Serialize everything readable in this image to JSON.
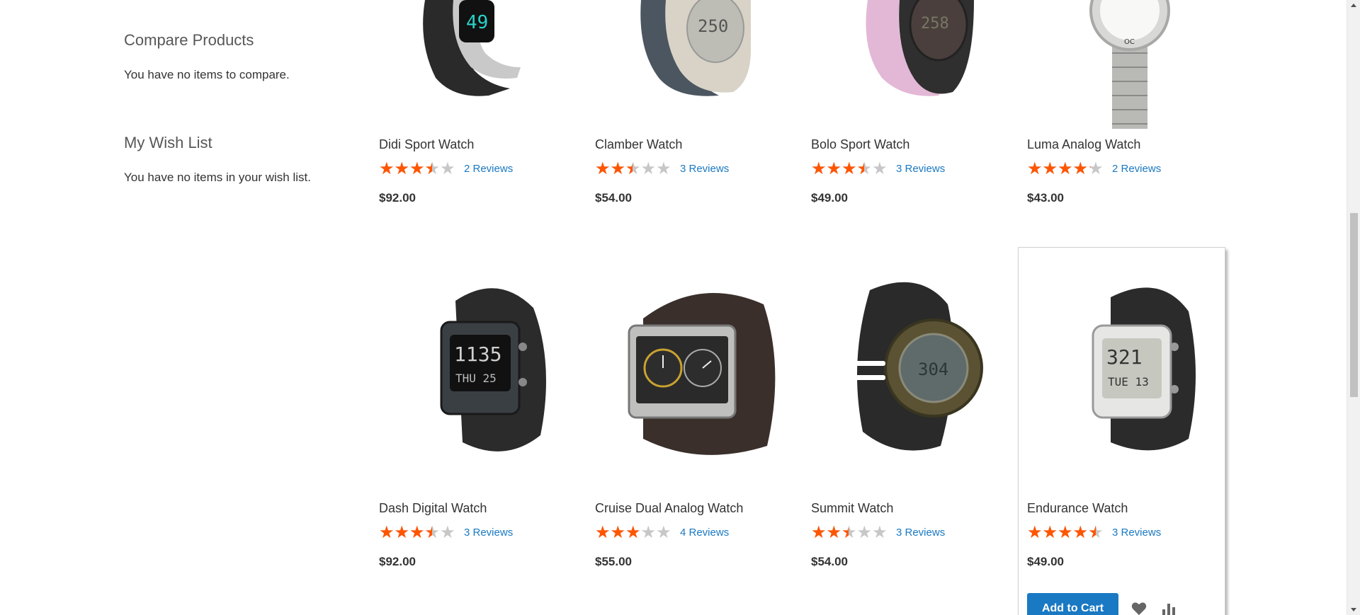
{
  "sidebar": {
    "compare_title": "Compare Products",
    "compare_empty": "You have no items to compare.",
    "wishlist_title": "My Wish List",
    "wishlist_empty": "You have no items in your wish list."
  },
  "products": [
    {
      "name": "Didi Sport Watch",
      "rating_percent": 67,
      "reviews": "2 Reviews",
      "price": "$92.00"
    },
    {
      "name": "Clamber Watch",
      "rating_percent": 47,
      "reviews": "3 Reviews",
      "price": "$54.00"
    },
    {
      "name": "Bolo Sport Watch",
      "rating_percent": 67,
      "reviews": "3 Reviews",
      "price": "$49.00"
    },
    {
      "name": "Luma Analog Watch",
      "rating_percent": 80,
      "reviews": "2 Reviews",
      "price": "$43.00"
    },
    {
      "name": "Dash Digital Watch",
      "rating_percent": 67,
      "reviews": "3 Reviews",
      "price": "$92.00"
    },
    {
      "name": "Cruise Dual Analog Watch",
      "rating_percent": 60,
      "reviews": "4 Reviews",
      "price": "$55.00"
    },
    {
      "name": "Summit Watch",
      "rating_percent": 47,
      "reviews": "3 Reviews",
      "price": "$54.00"
    },
    {
      "name": "Endurance Watch",
      "rating_percent": 87,
      "reviews": "3 Reviews",
      "price": "$49.00"
    }
  ],
  "actions": {
    "add_to_cart": "Add to Cart",
    "wishlist_icon": "heart-icon",
    "compare_icon": "bar-chart-icon"
  },
  "colors": {
    "star_active": "#ff5501",
    "star_inactive": "#c7c7c7",
    "link": "#1979c3",
    "button": "#1979c3"
  }
}
